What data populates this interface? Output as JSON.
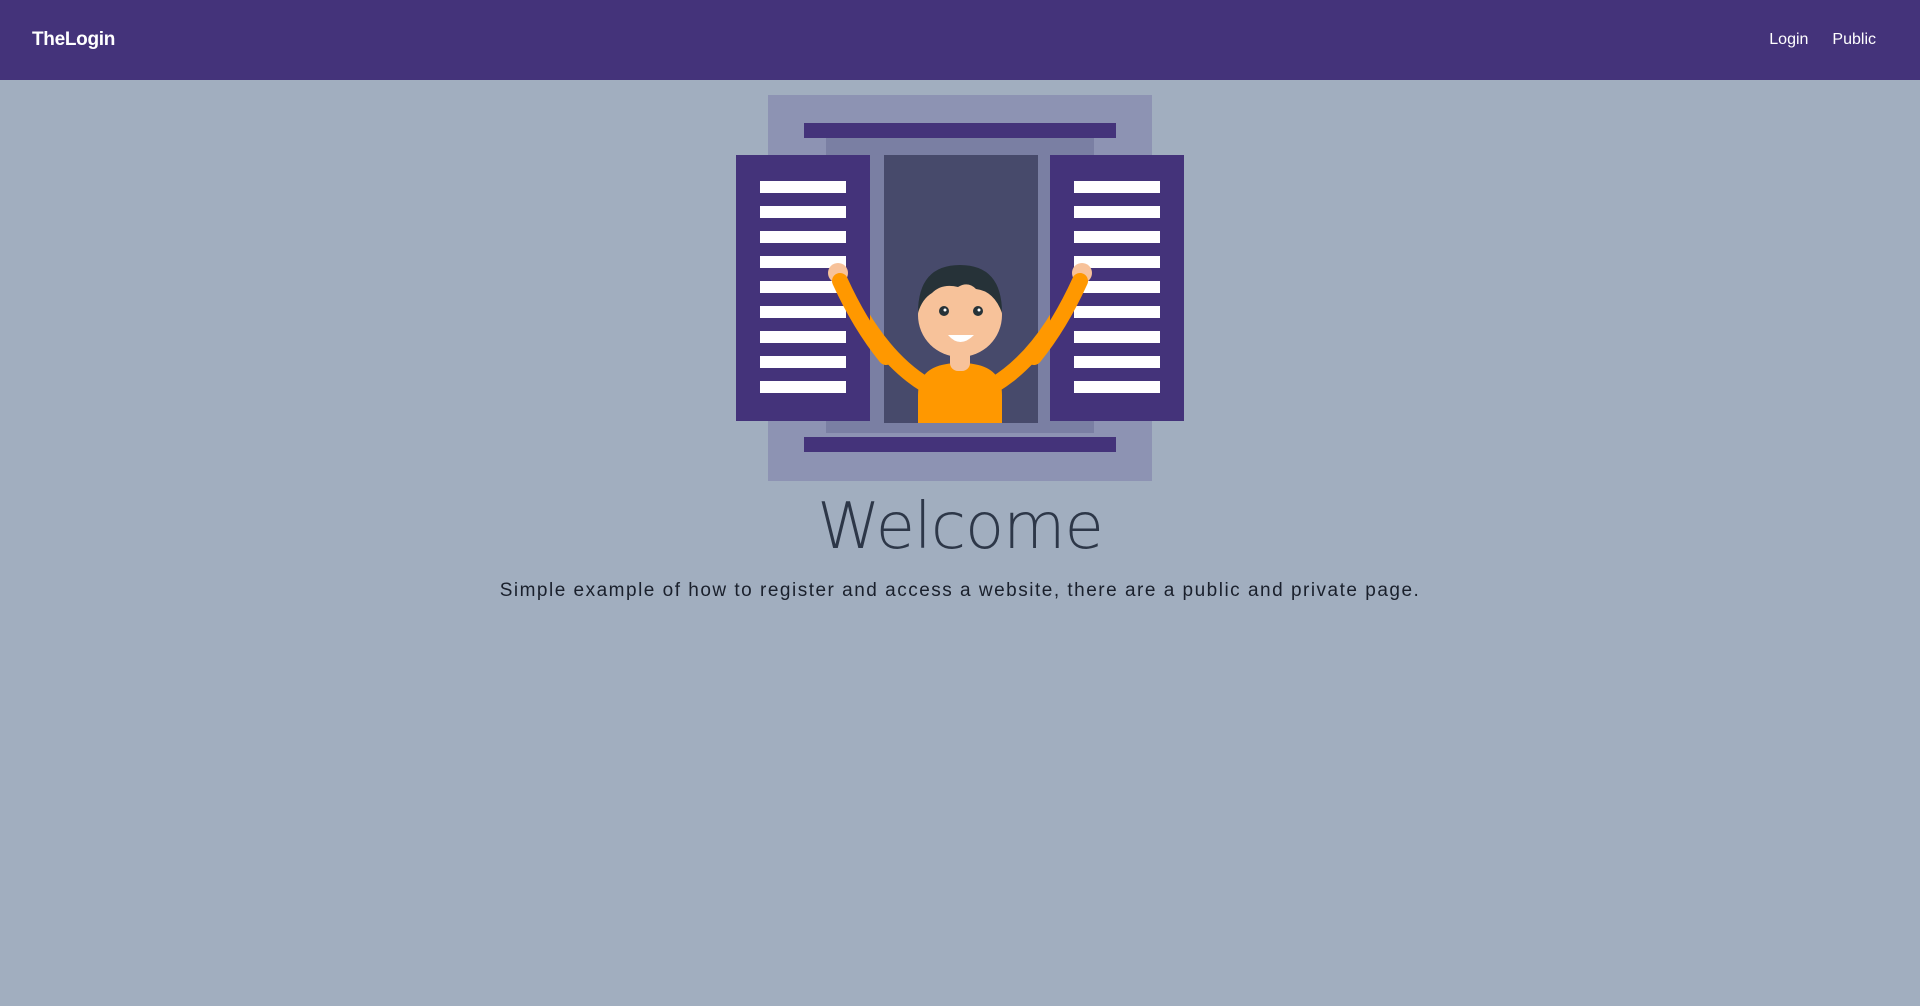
{
  "navbar": {
    "brand": "TheLogin",
    "links": [
      {
        "label": "Login"
      },
      {
        "label": "Public"
      }
    ]
  },
  "hero": {
    "illustration": "person-waving-from-window-illustration",
    "title": "Welcome",
    "subtitle": "Simple example of how to register and access a website, there are a public and private page."
  },
  "colors": {
    "navbar_bg": "#44337a",
    "page_bg": "#a1aebf",
    "shutter": "#44337a",
    "window_frame": "#8d93b3",
    "window_inner": "#474a6b",
    "shirt": "#ff9800",
    "skin": "#f7c29a"
  }
}
